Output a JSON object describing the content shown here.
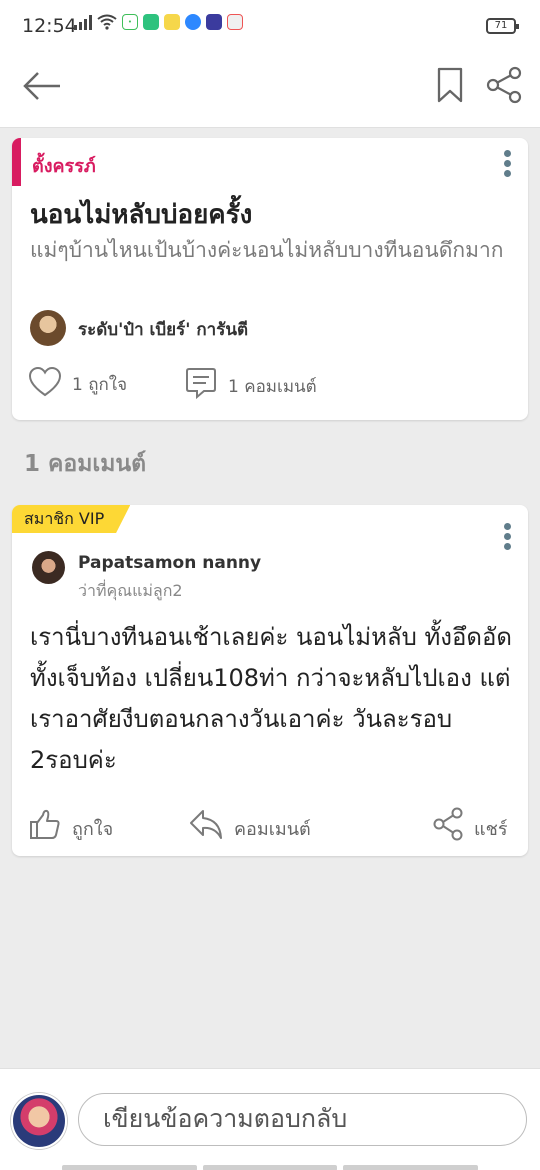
{
  "status_bar": {
    "time": "12:54",
    "battery": "71",
    "icons": [
      "signal-icon",
      "wifi-icon",
      "line-icon",
      "chat-app-icon",
      "font-app-icon",
      "messenger-icon",
      "video-app-icon",
      "flag-app-icon"
    ]
  },
  "app_bar": {
    "icons": [
      "back-arrow-icon",
      "bookmark-icon",
      "share-icon"
    ]
  },
  "post": {
    "category": "ตั้งครรภ์",
    "title": "นอนไม่หลับบ่อยครั้ง",
    "body": "แม่ๆบ้านไหนเป้นบ้างค่ะนอนไม่หลับบางทีนอนดึกมาก",
    "author_name": "ระดับ'ป๋า เบียร์' การันตี",
    "likes": "1 ถูกใจ",
    "comments": "1 คอมเมนต์"
  },
  "comments_section": {
    "heading": "1 คอมเมนต์"
  },
  "comment": {
    "badge": "สมาชิก VIP",
    "name": "Papatsamon nanny",
    "subtitle": "ว่าที่คุณแม่ลูก2",
    "text": "เรานี่บางทีนอนเช้าเลยค่ะ นอนไม่หลับ ทั้งอึดอัด ทั้งเจ็บท้อง เปลี่ยน108ท่า กว่าจะหลับไปเอง แต่เราอาศัยงีบตอนกลางวันเอาค่ะ วันละรอบ  2รอบค่ะ",
    "like_label": "ถูกใจ",
    "reply_label": "คอมเมนต์",
    "share_label": "แชร์"
  },
  "reply_bar": {
    "placeholder": "เขียนข้อความตอบกลับ"
  },
  "colors": {
    "accent_pink": "#d81b60",
    "vip_yellow": "#fdd835",
    "icon_grey": "#607d8b"
  }
}
